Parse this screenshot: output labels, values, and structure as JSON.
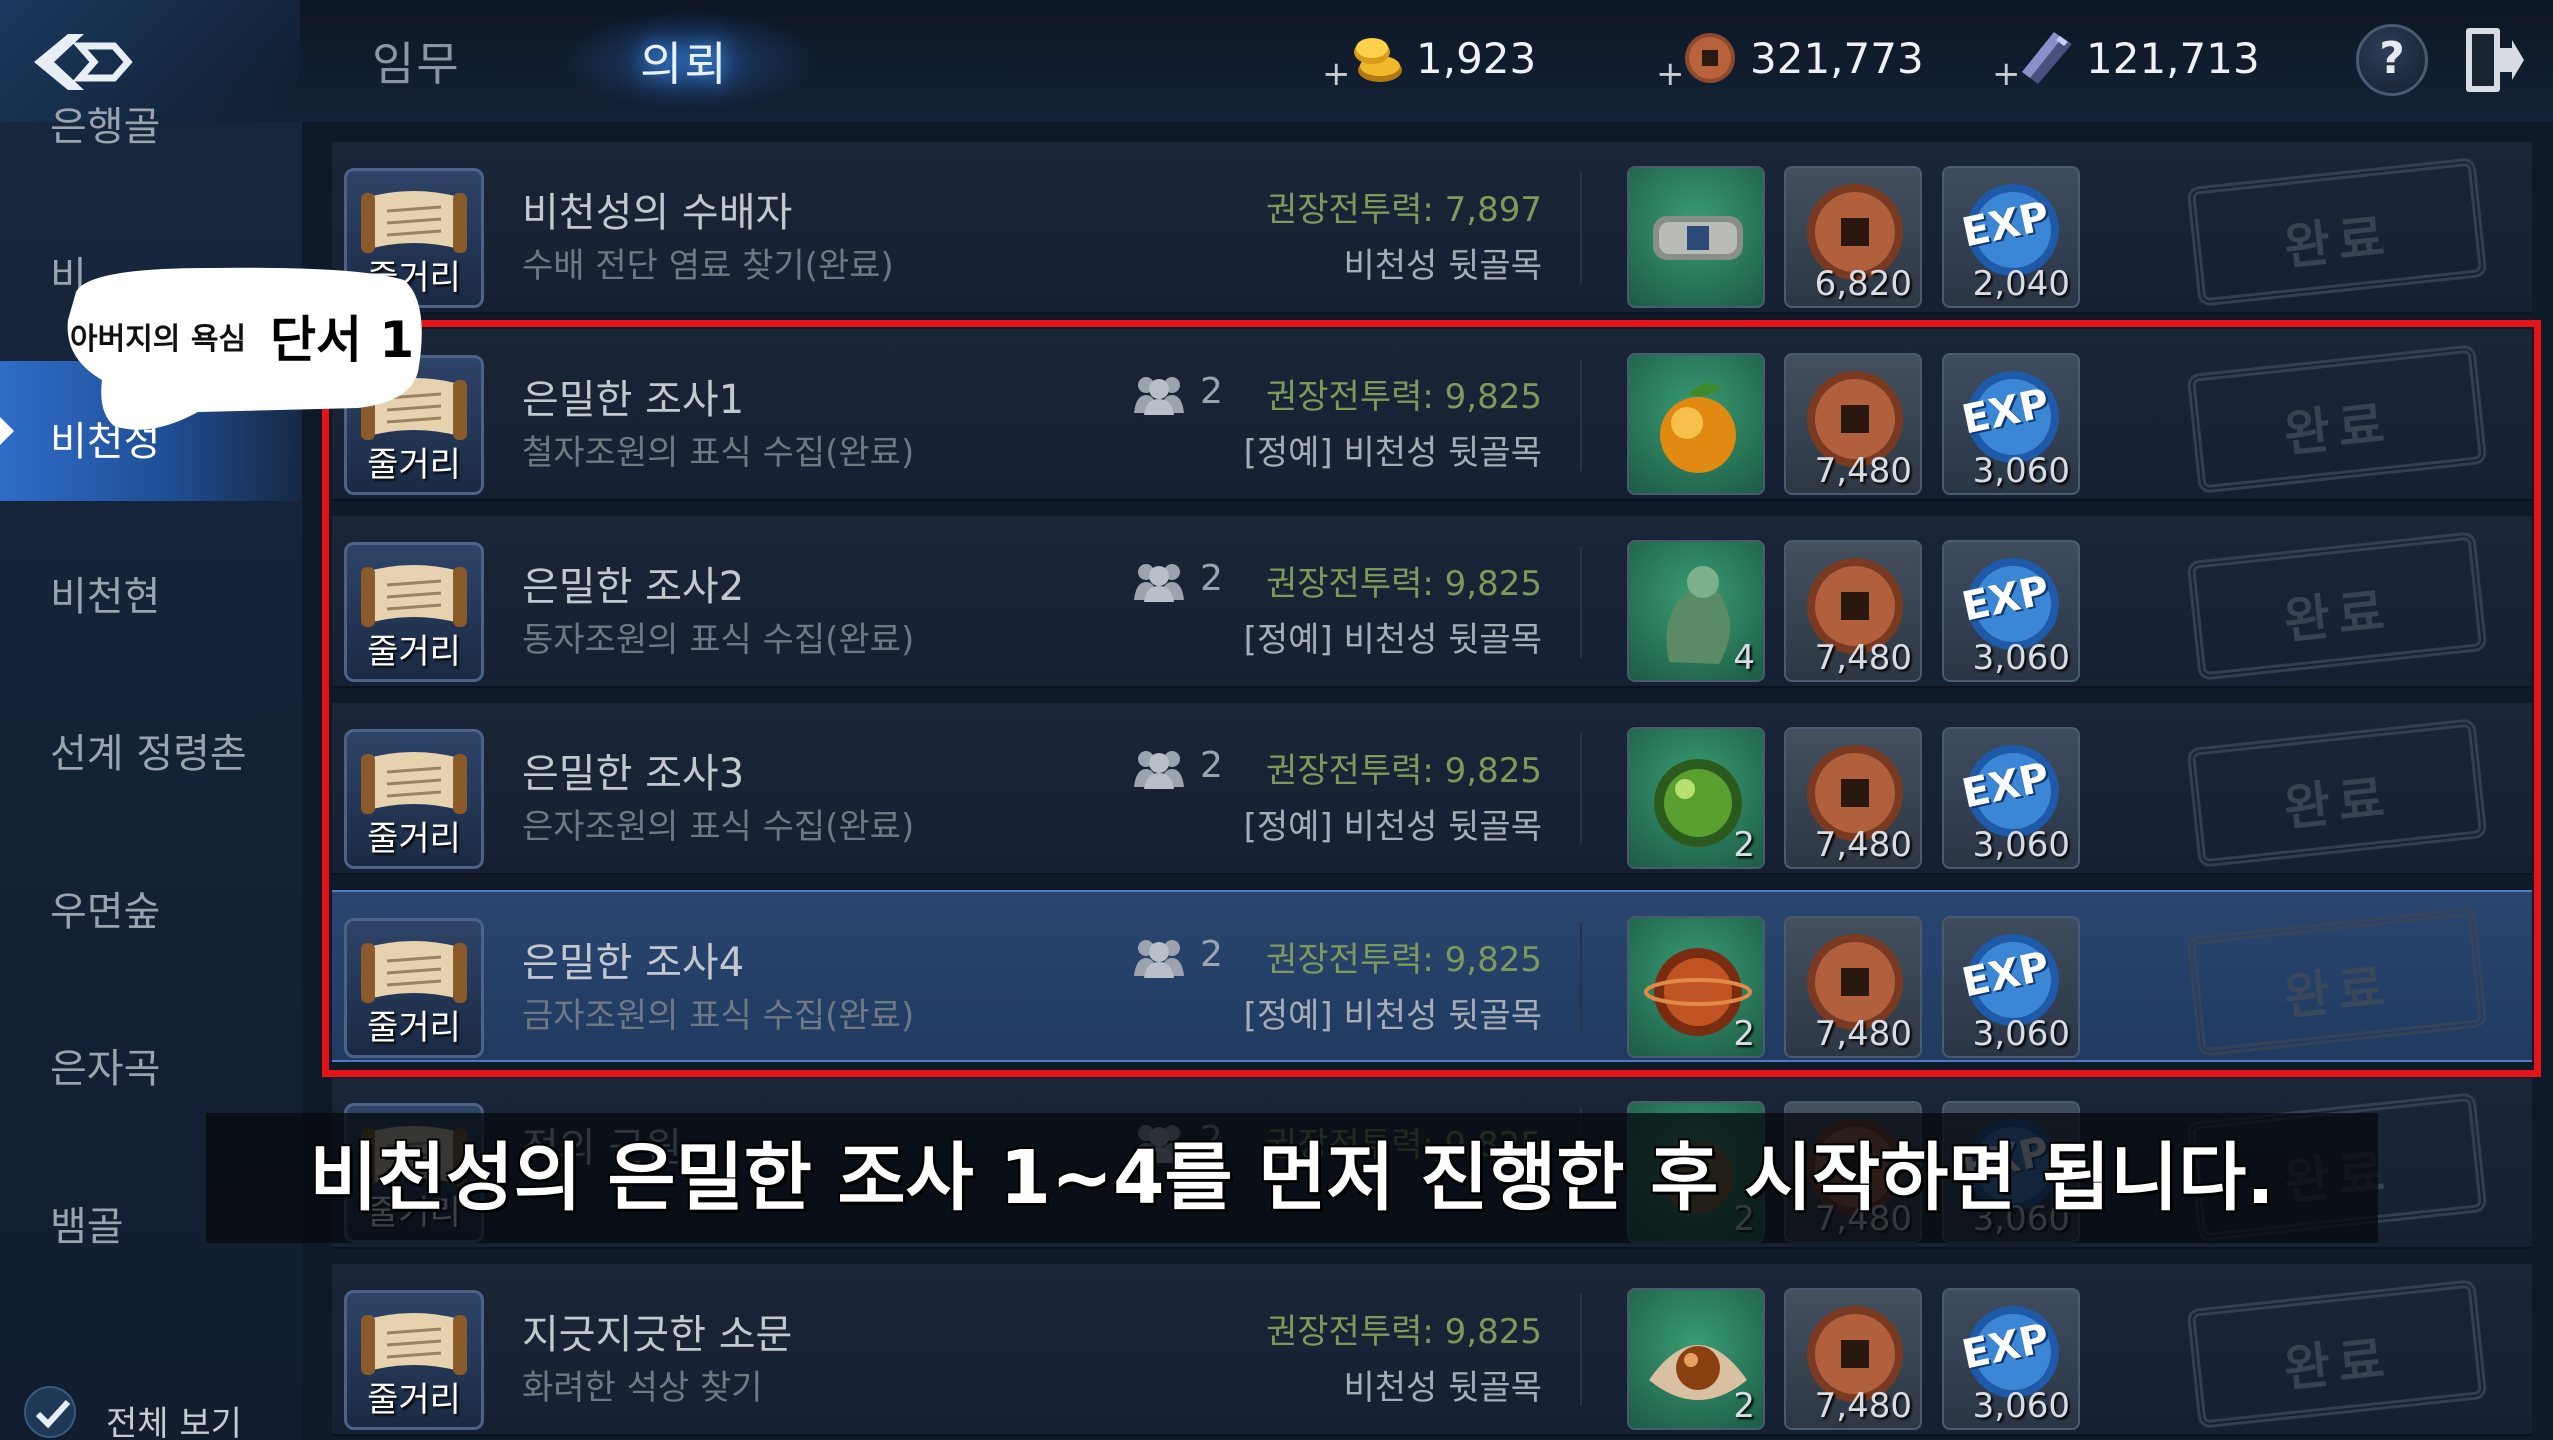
{
  "header": {
    "tabs": [
      {
        "label": "임무",
        "active": false
      },
      {
        "label": "의뢰",
        "active": true
      }
    ],
    "currencies": [
      {
        "icon": "gold-ingot-icon",
        "plus": "+",
        "value": "1,923"
      },
      {
        "icon": "bronze-coin-icon",
        "plus": "+",
        "value": "321,773"
      },
      {
        "icon": "crystal-icon",
        "plus": "+",
        "value": "121,713"
      }
    ],
    "help_label": "?"
  },
  "sidebar": {
    "items": [
      {
        "label": "은행골"
      },
      {
        "label": "비"
      },
      {
        "label": "비천성",
        "active": true
      },
      {
        "label": "비천현"
      },
      {
        "label": "선계 정령촌"
      },
      {
        "label": "우면숲"
      },
      {
        "label": "은자곡"
      },
      {
        "label": "뱀골"
      }
    ],
    "view_all_label": "전체 보기"
  },
  "quests": [
    {
      "icon_caption": "줄거리",
      "title": "비천성의 수배자",
      "subtitle": "수배 전단 염료 찾기(완료)",
      "party": "",
      "power": "권장전투력: 7,897",
      "location": "비천성 뒷골목",
      "reward1_icon": "bracelet-icon",
      "reward1_qty": "",
      "coin_qty": "6,820",
      "exp_label": "EXP",
      "exp_qty": "2,040",
      "stamp": "완료"
    },
    {
      "icon_caption": "줄거리",
      "title": "은밀한 조사1",
      "subtitle": "철자조원의 표식 수집(완료)",
      "party": "2",
      "power": "권장전투력: 9,825",
      "location": "[정예] 비천성 뒷골목",
      "reward1_icon": "orange-fruit-icon",
      "reward1_qty": "",
      "coin_qty": "7,480",
      "exp_label": "EXP",
      "exp_qty": "3,060",
      "stamp": "완료"
    },
    {
      "icon_caption": "줄거리",
      "title": "은밀한 조사2",
      "subtitle": "동자조원의 표식 수집(완료)",
      "party": "2",
      "power": "권장전투력: 9,825",
      "location": "[정예] 비천성 뒷골목",
      "reward1_icon": "dragon-statue-icon",
      "reward1_qty": "4",
      "coin_qty": "7,480",
      "exp_label": "EXP",
      "exp_qty": "3,060",
      "stamp": "완료"
    },
    {
      "icon_caption": "줄거리",
      "title": "은밀한 조사3",
      "subtitle": "은자조원의 표식 수집(완료)",
      "party": "2",
      "power": "권장전투력: 9,825",
      "location": "[정예] 비천성 뒷골목",
      "reward1_icon": "green-orb-icon",
      "reward1_qty": "2",
      "coin_qty": "7,480",
      "exp_label": "EXP",
      "exp_qty": "3,060",
      "stamp": "완료"
    },
    {
      "icon_caption": "줄거리",
      "title": "은밀한 조사4",
      "subtitle": "금자조원의 표식 수집(완료)",
      "party": "2",
      "power": "권장전투력: 9,825",
      "location": "[정예] 비천성 뒷골목",
      "reward1_icon": "red-orb-icon",
      "reward1_qty": "2",
      "coin_qty": "7,480",
      "exp_label": "EXP",
      "exp_qty": "3,060",
      "stamp": "완료",
      "selected": true
    },
    {
      "icon_caption": "줄거리",
      "title": "적의 근원",
      "subtitle": "",
      "party": "2",
      "power": "권장전투력: 9,825",
      "location": "",
      "reward1_icon": "item-icon",
      "reward1_qty": "2",
      "coin_qty": "7,480",
      "exp_label": "EXP",
      "exp_qty": "3,060",
      "stamp": "완료"
    },
    {
      "icon_caption": "줄거리",
      "title": "지긋지긋한 소문",
      "subtitle": "화려한 석상 찾기",
      "party": "",
      "power": "권장전투력: 9,825",
      "location": "비천성 뒷골목",
      "reward1_icon": "pearl-shell-icon",
      "reward1_qty": "2",
      "coin_qty": "7,480",
      "exp_label": "EXP",
      "exp_qty": "3,060",
      "stamp": "완료"
    }
  ],
  "overlay": {
    "bubble_small": "아버지의 욕심",
    "bubble_big": "단서 1",
    "subtitle": "비천성의 은밀한 조사 1~4를 먼저 진행한 후 시작하면 됩니다.",
    "highlight_color": "#e5121a"
  }
}
